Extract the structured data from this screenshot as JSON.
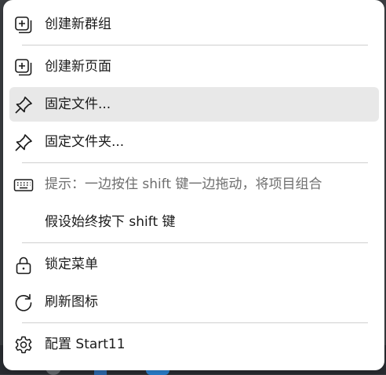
{
  "menu": {
    "items": [
      {
        "label": "创建新群组",
        "icon": "add-group-icon"
      },
      {
        "label": "创建新页面",
        "icon": "add-page-icon"
      },
      {
        "label": "固定文件...",
        "icon": "pin-icon"
      },
      {
        "label": "固定文件夹...",
        "icon": "pin-icon"
      },
      {
        "label": "提示：一边按住 shift 键一边拖动，将项目组合",
        "icon": "keyboard-icon"
      },
      {
        "label": "假设始终按下 shift 键"
      },
      {
        "label": "锁定菜单",
        "icon": "lock-icon"
      },
      {
        "label": "刷新图标",
        "icon": "refresh-icon"
      },
      {
        "label": "配置 Start11",
        "icon": "gear-icon"
      }
    ],
    "highlighted_index": 2
  }
}
